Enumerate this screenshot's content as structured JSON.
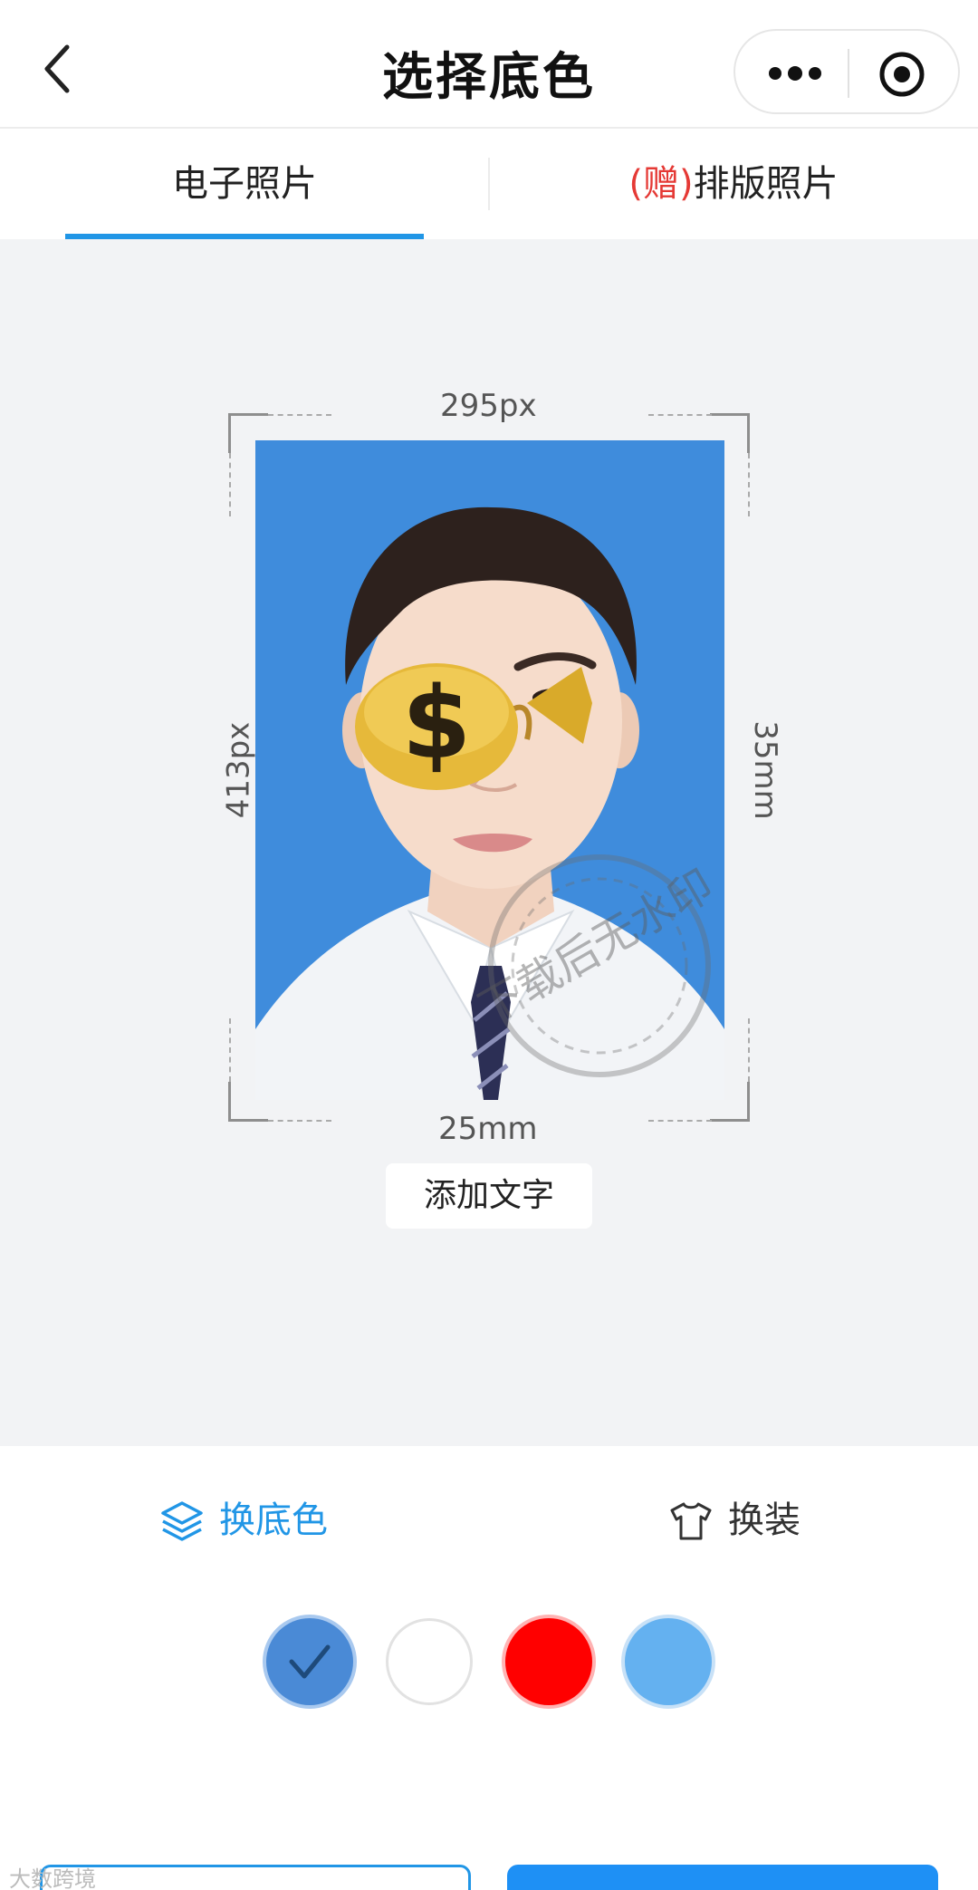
{
  "nav": {
    "title": "选择底色"
  },
  "tabs": {
    "electronic": "电子照片",
    "gift_mark": "(赠)",
    "layout": "排版照片"
  },
  "preview": {
    "width_px": "295px",
    "height_px": "413px",
    "width_mm": "25mm",
    "height_mm": "35mm",
    "watermark_text": "下载后无水印",
    "add_text_button": "添加文字"
  },
  "tools": {
    "change_bg": "换底色",
    "change_clothes": "换装"
  },
  "swatches": [
    {
      "color": "#4a8ad6",
      "selected": true
    },
    {
      "color": "#ffffff",
      "selected": false
    },
    {
      "color": "#ff0000",
      "selected": false
    },
    {
      "color": "#64b1f0",
      "selected": false
    }
  ],
  "footer_watermark": "大数跨境"
}
